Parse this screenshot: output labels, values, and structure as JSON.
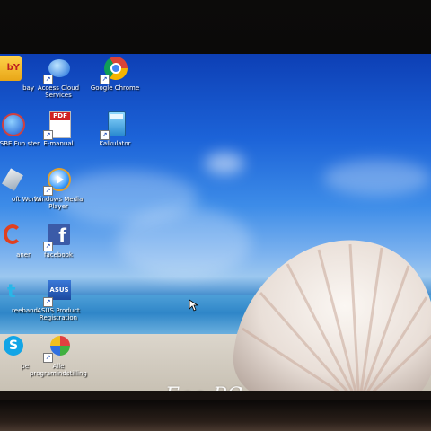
{
  "desktop": {
    "brand": "Eee PC",
    "icons": [
      {
        "label": "bay",
        "icon": "ebay-icon"
      },
      {
        "label": "Access Cloud Services",
        "icon": "cloud-icon"
      },
      {
        "label": "Google Chrome",
        "icon": "chrome-icon"
      },
      {
        "label": "SBE Fun ster",
        "icon": "globe-icon"
      },
      {
        "label": "E-manual",
        "icon": "pdf-icon"
      },
      {
        "label": "Kalkulator",
        "icon": "calculator-icon"
      },
      {
        "label": "oft Works",
        "icon": "works-icon"
      },
      {
        "label": "Windows Media Player",
        "icon": "media-player-icon"
      },
      {
        "label": "aner",
        "icon": "cleaner-icon"
      },
      {
        "label": "facebook",
        "icon": "facebook-icon"
      },
      {
        "label": "reeband",
        "icon": "broadband-icon"
      },
      {
        "label": "ASUS Product Registration",
        "icon": "asus-icon"
      },
      {
        "label": "pe",
        "icon": "skype-icon"
      },
      {
        "label": "Alle programindstilling",
        "icon": "settings-icon"
      }
    ]
  },
  "colors": {
    "taskbar": "#2c6fd6",
    "sky": "#1c63d8",
    "sand": "#cfc9bd"
  }
}
